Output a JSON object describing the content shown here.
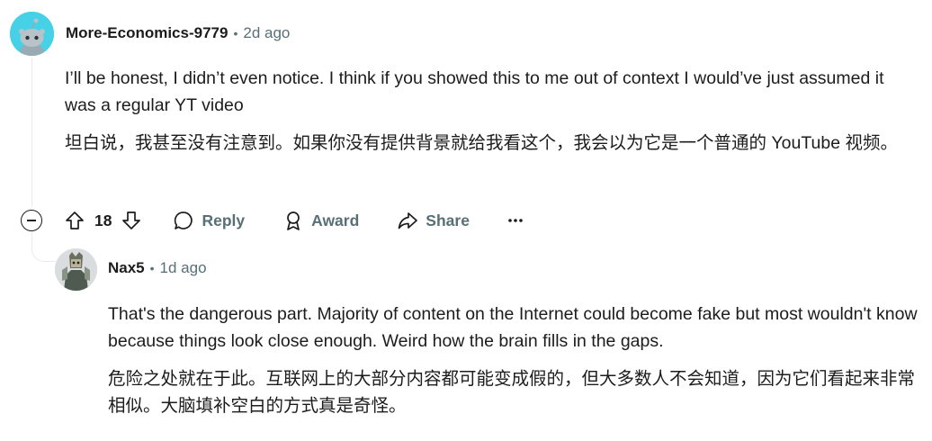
{
  "comments": [
    {
      "author": "More-Economics-9779",
      "time": "2d ago",
      "text_en": "I’ll be honest, I didn’t even notice. I think if you showed this to me out of context I would’ve just assumed it was a regular YT video",
      "text_zh": "坦白说，我甚至没有注意到。如果你没有提供背景就给我看这个，我会以为它是一个普通的 YouTube 视频。",
      "votes": "18"
    },
    {
      "author": "Nax5",
      "time": "1d ago",
      "text_en": "That's the dangerous part. Majority of content on the Internet could become fake but most wouldn't know because things look close enough. Weird how the brain fills in the gaps.",
      "text_zh": "危险之处就在于此。互联网上的大部分内容都可能变成假的，但大多数人不会知道，因为它们看起来非常相似。大脑填补空白的方式真是奇怪。"
    }
  ],
  "actions": {
    "reply": "Reply",
    "award": "Award",
    "share": "Share"
  },
  "icons": [
    "collapse-icon",
    "upvote-icon",
    "downvote-icon",
    "comment-icon",
    "award-icon",
    "share-icon",
    "more-icon"
  ]
}
